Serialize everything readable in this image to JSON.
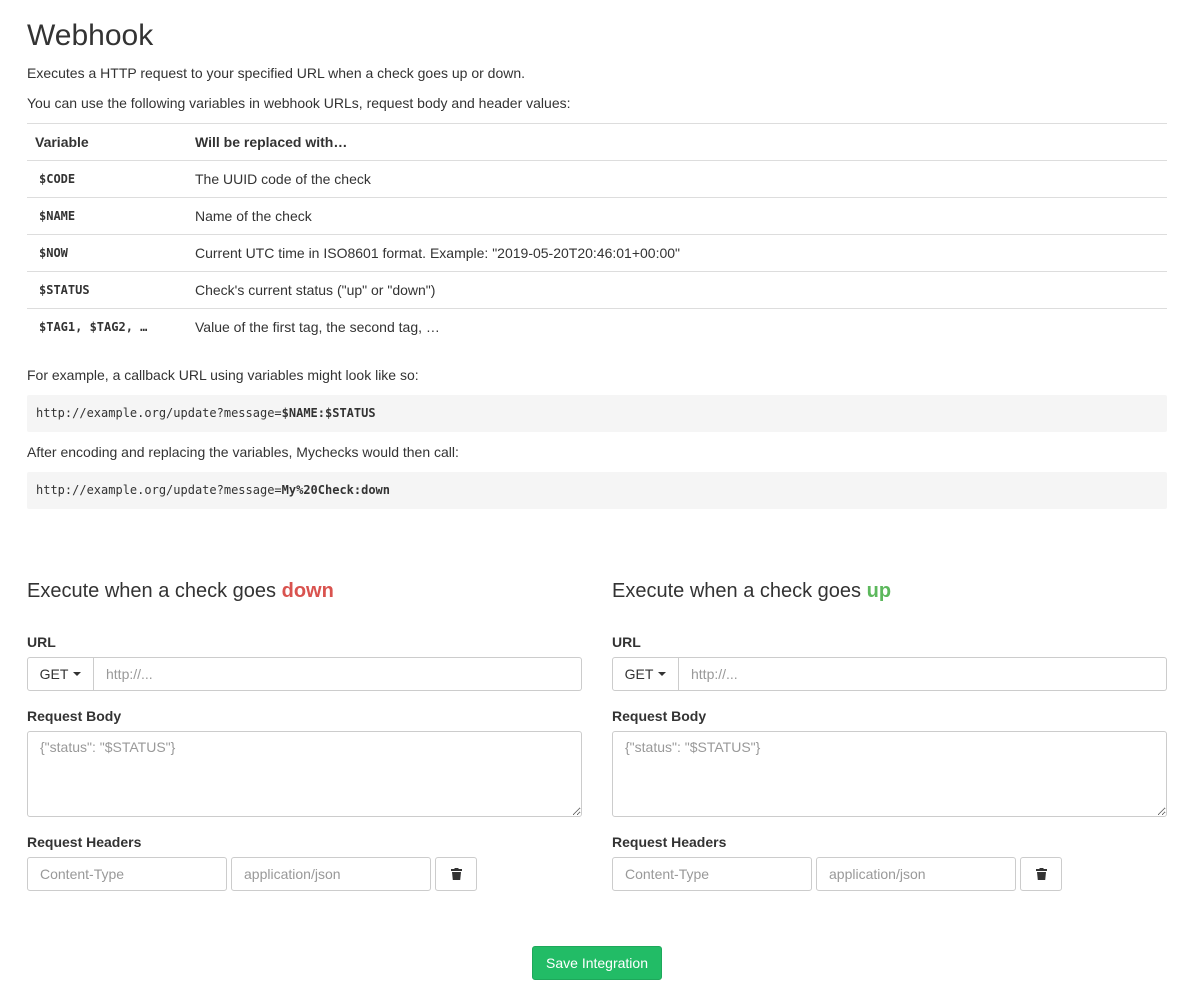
{
  "title": "Webhook",
  "intro": "Executes a HTTP request to your specified URL when a check goes up or down.",
  "vars_intro": "You can use the following variables in webhook URLs, request body and header values:",
  "variables_table": {
    "headers": [
      "Variable",
      "Will be replaced with…"
    ],
    "rows": [
      {
        "name": "$CODE",
        "desc": "The UUID code of the check"
      },
      {
        "name": "$NAME",
        "desc": "Name of the check"
      },
      {
        "name": "$NOW",
        "desc": "Current UTC time in ISO8601 format. Example: \"2019-05-20T20:46:01+00:00\""
      },
      {
        "name": "$STATUS",
        "desc": "Check's current status (\"up\" or \"down\")"
      },
      {
        "name": "$TAG1, $TAG2, …",
        "desc": "Value of the first tag, the second tag, …"
      }
    ]
  },
  "example_intro": "For example, a callback URL using variables might look like so:",
  "example_url": {
    "prefix": "http://example.org/update?message=",
    "vars": "$NAME:$STATUS"
  },
  "encoded_intro": "After encoding and replacing the variables, Mychecks would then call:",
  "encoded_url": {
    "prefix": "http://example.org/update?message=",
    "vars": "My%20Check:down"
  },
  "down_section": {
    "heading_prefix": "Execute when a check goes ",
    "heading_status": "down",
    "url_label": "URL",
    "method": "GET",
    "url_placeholder": "http://...",
    "body_label": "Request Body",
    "body_placeholder": "{\"status\": \"$STATUS\"}",
    "headers_label": "Request Headers",
    "header_name_placeholder": "Content-Type",
    "header_value_placeholder": "application/json"
  },
  "up_section": {
    "heading_prefix": "Execute when a check goes ",
    "heading_status": "up",
    "url_label": "URL",
    "method": "GET",
    "url_placeholder": "http://...",
    "body_label": "Request Body",
    "body_placeholder": "{\"status\": \"$STATUS\"}",
    "headers_label": "Request Headers",
    "header_name_placeholder": "Content-Type",
    "header_value_placeholder": "application/json"
  },
  "save_label": "Save Integration",
  "colors": {
    "down": "#d9534f",
    "up": "#5cb85c",
    "save": "#22bc66"
  },
  "icons": {
    "delete": "trash-icon",
    "method_dropdown": "caret-down-icon"
  }
}
